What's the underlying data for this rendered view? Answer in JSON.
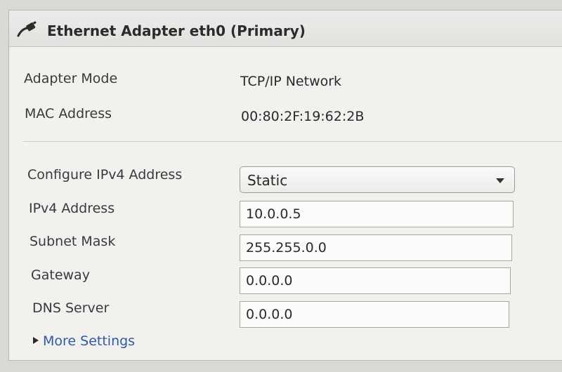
{
  "header": {
    "title": "Ethernet Adapter eth0 (Primary)",
    "icon": "ethernet-cable-icon"
  },
  "info": {
    "adapter_mode_label": "Adapter Mode",
    "adapter_mode_value": "TCP/IP Network",
    "mac_address_label": "MAC Address",
    "mac_address_value": "00:80:2F:19:62:2B"
  },
  "form": {
    "configure_ipv4_label": "Configure IPv4 Address",
    "configure_ipv4_value": "Static",
    "ipv4_address_label": "IPv4 Address",
    "ipv4_address_value": "10.0.0.5",
    "subnet_mask_label": "Subnet Mask",
    "subnet_mask_value": "255.255.0.0",
    "gateway_label": "Gateway",
    "gateway_value": "0.0.0.0",
    "dns_server_label": "DNS Server",
    "dns_server_value": "0.0.0.0"
  },
  "more_settings": {
    "label": "More Settings"
  },
  "colors": {
    "panel_background": "#f1f1ee",
    "link": "#2f5aa8",
    "text": "#2a2a2a"
  }
}
